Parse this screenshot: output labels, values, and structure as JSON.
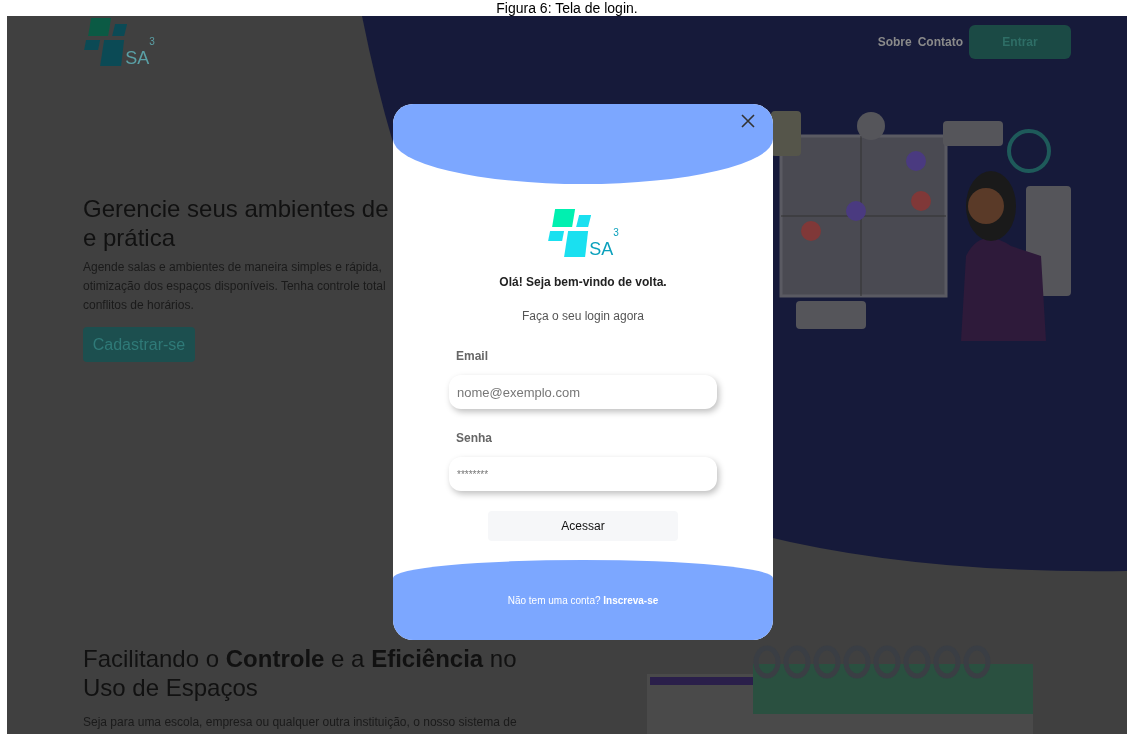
{
  "caption": "Figura 6: Tela de login.",
  "header": {
    "logo": {
      "letters": "SA",
      "superscript": "3"
    },
    "nav": [
      "Sobre",
      "Contato"
    ],
    "cta": "Entrar"
  },
  "hero": {
    "title_lines": [
      "Gerencie seus ambientes de",
      "e prática"
    ],
    "text_lines": [
      "Agende salas e ambientes de maneira simples e rápida,",
      "otimização dos espaços disponíveis. Tenha controle total",
      "conflitos de horários."
    ],
    "button": "Cadastrar-se"
  },
  "features": {
    "title": "Facilitando o **Controle** e a **Eficiência** no Uso de Espaços",
    "text": "Seja para uma escola, empresa ou qualquer outra instituição, o nosso sistema de"
  },
  "login_modal": {
    "logo": {
      "letters": "SA",
      "superscript": "3"
    },
    "greeting": "Olá! Seja bem-vindo de volta.",
    "subtitle": "Faça o seu login agora",
    "fields": [
      {
        "label": "Email",
        "placeholder": "nome@exemplo.com",
        "kind": "text"
      },
      {
        "label": "Senha",
        "placeholder": "********",
        "kind": "secret"
      }
    ],
    "submit": "Acessar",
    "signup_prompt": "Não tem uma conta?",
    "signup_link": "Inscreva-se"
  }
}
